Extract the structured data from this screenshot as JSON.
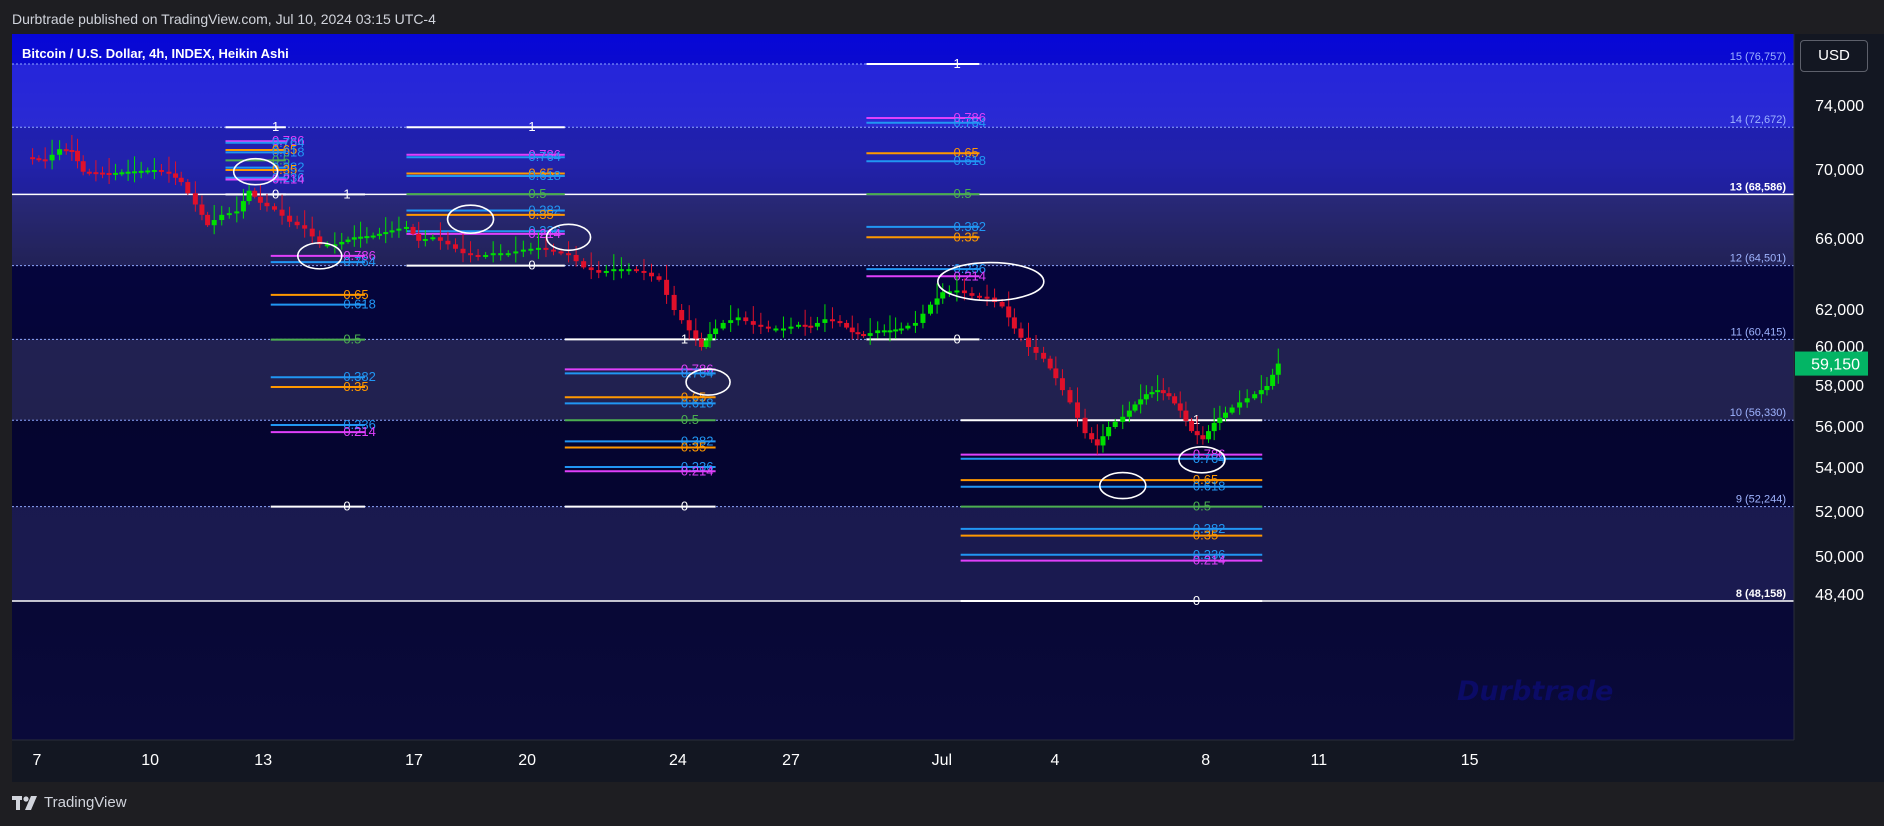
{
  "header": {
    "published": "Durbtrade published on TradingView.com, Jul 10, 2024 03:15 UTC-4"
  },
  "footer": {
    "brand": "TradingView"
  },
  "watermark": "Durbtrade",
  "colors": {
    "up": "#00e000",
    "down": "#e0102a",
    "fib_236": "#2196f3",
    "fib_214": "#e040fb",
    "fib_35": "#ff9800",
    "fib_05": "#4caf50",
    "fib_1": "#ffffff"
  },
  "chart_data": {
    "type": "candlestick",
    "title": "Bitcoin / U.S. Dollar, 4h, INDEX, Heikin Ashi",
    "currency": "USD",
    "last_price": 59150,
    "last_price_label": "59,150",
    "y_ticks": [
      48400,
      50000,
      52000,
      54000,
      56000,
      58000,
      60000,
      62000,
      66000,
      70000,
      74000
    ],
    "y_tick_labels": [
      "48,400",
      "50,000",
      "52,000",
      "54,000",
      "56,000",
      "58,000",
      "60,000",
      "62,000",
      "66,000",
      "70,000",
      "74,000"
    ],
    "x_ticks": [
      {
        "label": "7",
        "day": 7
      },
      {
        "label": "10",
        "day": 10
      },
      {
        "label": "13",
        "day": 13
      },
      {
        "label": "17",
        "day": 17
      },
      {
        "label": "20",
        "day": 20
      },
      {
        "label": "24",
        "day": 24
      },
      {
        "label": "27",
        "day": 27
      },
      {
        "label": "Jul",
        "day": 31
      },
      {
        "label": "4",
        "day": 34
      },
      {
        "label": "8",
        "day": 38
      },
      {
        "label": "11",
        "day": 41
      },
      {
        "label": "15",
        "day": 45
      }
    ],
    "grid_levels": [
      {
        "label": "15 (76,757)",
        "value": 76757,
        "bold": false
      },
      {
        "label": "14 (72,672)",
        "value": 72672,
        "bold": false
      },
      {
        "label": "13 (68,586)",
        "value": 68586,
        "bold": true
      },
      {
        "label": "12 (64,501)",
        "value": 64501,
        "bold": false
      },
      {
        "label": "11 (60,415)",
        "value": 60415,
        "bold": false
      },
      {
        "label": "10 (56,330)",
        "value": 56330,
        "bold": false
      },
      {
        "label": "9 (52,244)",
        "value": 52244,
        "bold": false
      },
      {
        "label": "8 (48,158)",
        "value": 48158,
        "bold": true
      }
    ],
    "fib_retracements": [
      {
        "x_from": 12.0,
        "x_to": 13.6,
        "high": 72672,
        "low": 68586,
        "labels": [
          [
            "1",
            72672
          ],
          [
            "0.786",
            71800
          ],
          [
            "0.764",
            71700
          ],
          [
            "0.65",
            71250
          ],
          [
            "0.618",
            71100
          ],
          [
            "0.5",
            70600
          ],
          [
            "0.382",
            70150
          ],
          [
            "0.35",
            70000
          ],
          [
            "0.236",
            69550
          ],
          [
            "0.214",
            69450
          ],
          [
            "0",
            68586
          ]
        ]
      },
      {
        "x_from": 16.8,
        "x_to": 21.0,
        "high": 72672,
        "low": 64501,
        "labels": [
          [
            "1",
            72672
          ],
          [
            "0.786",
            70950
          ],
          [
            "0.764",
            70800
          ],
          [
            "0.65",
            69800
          ],
          [
            "0.618",
            69650
          ],
          [
            "0.5",
            68600
          ],
          [
            "0.382",
            67650
          ],
          [
            "0.35",
            67400
          ],
          [
            "0.236",
            66450
          ],
          [
            "0.214",
            66300
          ],
          [
            "0",
            64501
          ]
        ]
      },
      {
        "x_from": 13.2,
        "x_to": 15.7,
        "high": 68586,
        "low": 52244,
        "labels": [
          [
            "1",
            68586
          ],
          [
            "0.786",
            65050
          ],
          [
            "0.764",
            64700
          ],
          [
            "0.65",
            62850
          ],
          [
            "0.618",
            62300
          ],
          [
            "0.5",
            60400
          ],
          [
            "0.382",
            58450
          ],
          [
            "0.35",
            57950
          ],
          [
            "0.236",
            56100
          ],
          [
            "0.214",
            55750
          ],
          [
            "0",
            52244
          ]
        ]
      },
      {
        "x_from": 21.0,
        "x_to": 25.0,
        "high": 64501,
        "low": 52244,
        "labels": [
          [
            "1",
            60415
          ],
          [
            "0.786",
            58850
          ],
          [
            "0.764",
            58650
          ],
          [
            "0.65",
            57450
          ],
          [
            "0.618",
            57150
          ],
          [
            "0.5",
            56330
          ],
          [
            "0.382",
            55300
          ],
          [
            "0.35",
            55000
          ],
          [
            "0.236",
            54050
          ],
          [
            "0.214",
            53850
          ],
          [
            "0",
            52244
          ]
        ]
      },
      {
        "x_from": 29.0,
        "x_to": 32.0,
        "high": 76757,
        "low": 60415,
        "labels": [
          [
            "1",
            76757
          ],
          [
            "0.786",
            73250
          ],
          [
            "0.764",
            72950
          ],
          [
            "0.65",
            71050
          ],
          [
            "0.618",
            70550
          ],
          [
            "0.5",
            68600
          ],
          [
            "0.382",
            66700
          ],
          [
            "0.35",
            66100
          ],
          [
            "0.236",
            64300
          ],
          [
            "0.214",
            63900
          ],
          [
            "0",
            60415
          ]
        ]
      },
      {
        "x_from": 31.5,
        "x_to": 39.5,
        "high": 56330,
        "low": 48158,
        "labels": [
          [
            "1",
            56330
          ],
          [
            "0.786",
            54650
          ],
          [
            "0.764",
            54450
          ],
          [
            "0.65",
            53450
          ],
          [
            "0.618",
            53150
          ],
          [
            "0.5",
            52244
          ],
          [
            "0.382",
            51250
          ],
          [
            "0.35",
            50950
          ],
          [
            "0.236",
            50100
          ],
          [
            "0.214",
            49850
          ],
          [
            "0",
            48158
          ]
        ]
      }
    ],
    "highlight_ellipses": [
      {
        "day": 12.8,
        "price": 69900,
        "w": 44,
        "h": 26
      },
      {
        "day": 14.5,
        "price": 65050,
        "w": 44,
        "h": 26
      },
      {
        "day": 18.5,
        "price": 67150,
        "w": 46,
        "h": 28
      },
      {
        "day": 21.1,
        "price": 66100,
        "w": 44,
        "h": 26
      },
      {
        "day": 24.8,
        "price": 58200,
        "w": 44,
        "h": 26
      },
      {
        "day": 32.3,
        "price": 63600,
        "w": 106,
        "h": 38
      },
      {
        "day": 35.8,
        "price": 53200,
        "w": 46,
        "h": 26
      },
      {
        "day": 37.9,
        "price": 54400,
        "w": 46,
        "h": 26
      }
    ],
    "ohlc_path": [
      [
        6.8,
        70800
      ],
      [
        7.3,
        70600
      ],
      [
        7.7,
        71300
      ],
      [
        8.0,
        71200
      ],
      [
        8.3,
        69900
      ],
      [
        9.0,
        69800
      ],
      [
        9.5,
        69900
      ],
      [
        10.2,
        70000
      ],
      [
        10.6,
        69800
      ],
      [
        10.9,
        69300
      ],
      [
        11.3,
        68000
      ],
      [
        11.6,
        66800
      ],
      [
        12.0,
        67400
      ],
      [
        12.4,
        67600
      ],
      [
        12.7,
        68800
      ],
      [
        13.0,
        68100
      ],
      [
        13.4,
        67700
      ],
      [
        13.8,
        67000
      ],
      [
        14.2,
        66600
      ],
      [
        14.6,
        65700
      ],
      [
        15.0,
        65700
      ],
      [
        15.5,
        66100
      ],
      [
        16.0,
        66200
      ],
      [
        16.5,
        66500
      ],
      [
        16.9,
        66700
      ],
      [
        17.2,
        65900
      ],
      [
        17.6,
        66100
      ],
      [
        18.0,
        65700
      ],
      [
        18.4,
        65200
      ],
      [
        18.8,
        65000
      ],
      [
        19.2,
        65200
      ],
      [
        19.6,
        65200
      ],
      [
        20.0,
        65400
      ],
      [
        20.4,
        65500
      ],
      [
        20.8,
        65300
      ],
      [
        21.2,
        65100
      ],
      [
        21.6,
        64400
      ],
      [
        22.0,
        64100
      ],
      [
        22.4,
        64300
      ],
      [
        22.8,
        64300
      ],
      [
        23.2,
        64100
      ],
      [
        23.6,
        63700
      ],
      [
        24.0,
        62000
      ],
      [
        24.4,
        60900
      ],
      [
        24.7,
        60000
      ],
      [
        24.9,
        60700
      ],
      [
        25.3,
        61300
      ],
      [
        25.7,
        61600
      ],
      [
        26.1,
        61200
      ],
      [
        26.5,
        61000
      ],
      [
        26.9,
        61000
      ],
      [
        27.3,
        61200
      ],
      [
        27.6,
        61100
      ],
      [
        28.0,
        61500
      ],
      [
        28.4,
        61300
      ],
      [
        28.7,
        60800
      ],
      [
        29.0,
        60600
      ],
      [
        29.4,
        60900
      ],
      [
        29.7,
        60900
      ],
      [
        30.0,
        61000
      ],
      [
        30.4,
        61300
      ],
      [
        30.8,
        62300
      ],
      [
        31.1,
        63000
      ],
      [
        31.5,
        63100
      ],
      [
        31.9,
        62800
      ],
      [
        32.3,
        62700
      ],
      [
        32.7,
        62200
      ],
      [
        33.0,
        61000
      ],
      [
        33.4,
        60000
      ],
      [
        33.8,
        59400
      ],
      [
        34.1,
        58400
      ],
      [
        34.5,
        57200
      ],
      [
        34.9,
        55700
      ],
      [
        35.2,
        55100
      ],
      [
        35.5,
        56000
      ],
      [
        35.9,
        56500
      ],
      [
        36.2,
        57100
      ],
      [
        36.5,
        57600
      ],
      [
        36.8,
        57800
      ],
      [
        37.1,
        57500
      ],
      [
        37.4,
        56800
      ],
      [
        37.7,
        55800
      ],
      [
        38.0,
        55400
      ],
      [
        38.3,
        56200
      ],
      [
        38.6,
        56700
      ],
      [
        39.0,
        57200
      ],
      [
        39.4,
        57600
      ],
      [
        39.7,
        58000
      ],
      [
        40.0,
        59150
      ]
    ]
  }
}
